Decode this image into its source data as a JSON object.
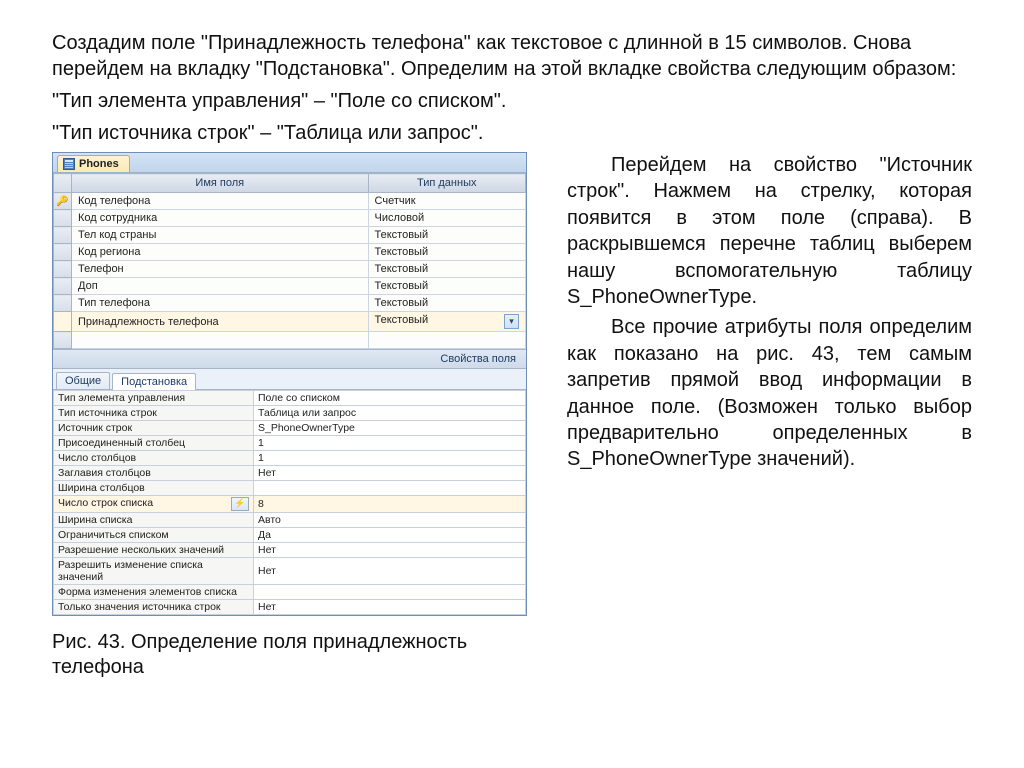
{
  "intro": {
    "p1": "Создадим поле \"Принадлежность телефона\" как текстовое с длинной в 15 символов.  Снова перейдем на вкладку \"Подстановка\". Определим на этой вкладке свойства следующим образом:",
    "p2": "\"Тип элемента управления\" – \"Поле со списком\".",
    "p3": "\"Тип источника строк\" – \"Таблица или запрос\"."
  },
  "right": {
    "p1": "Перейдем на свойство \"Источник строк\". Нажмем на стрелку, которая появится в этом поле (справа). В раскрывшемся перечне таблиц выберем нашу вспомогательную таблицу S_PhoneOwnerType.",
    "p2": "Все прочие атрибуты поля определим как показано на рис. 43, тем самым запретив прямой ввод информации в данное поле. (Возможен только выбор предварительно определенных в S_PhoneOwnerType значений)."
  },
  "figcaption": "Рис. 43. Определение поля принадлежность телефона",
  "access": {
    "tab": "Phones",
    "header": {
      "field": "Имя поля",
      "type": "Тип данных"
    },
    "fields": [
      {
        "key": true,
        "name": "Код телефона",
        "type": "Счетчик"
      },
      {
        "key": false,
        "name": "Код сотрудника",
        "type": "Числовой"
      },
      {
        "key": false,
        "name": "Тел код страны",
        "type": "Текстовый"
      },
      {
        "key": false,
        "name": "Код региона",
        "type": "Текстовый"
      },
      {
        "key": false,
        "name": "Телефон",
        "type": "Текстовый"
      },
      {
        "key": false,
        "name": "Доп",
        "type": "Текстовый"
      },
      {
        "key": false,
        "name": "Тип телефона",
        "type": "Текстовый"
      },
      {
        "key": false,
        "name": "Принадлежность телефона",
        "type": "Текстовый",
        "selected": true
      }
    ],
    "props_title": "Свойства поля",
    "tabs": {
      "general": "Общие",
      "lookup": "Подстановка"
    },
    "properties": [
      {
        "name": "Тип элемента управления",
        "value": "Поле со списком"
      },
      {
        "name": "Тип источника строк",
        "value": "Таблица или запрос"
      },
      {
        "name": "Источник строк",
        "value": "S_PhoneOwnerType"
      },
      {
        "name": "Присоединенный столбец",
        "value": "1"
      },
      {
        "name": "Число столбцов",
        "value": "1"
      },
      {
        "name": "Заглавия столбцов",
        "value": "Нет"
      },
      {
        "name": "Ширина столбцов",
        "value": ""
      },
      {
        "name": "Число строк списка",
        "value": "8",
        "current": true
      },
      {
        "name": "Ширина списка",
        "value": "Авто"
      },
      {
        "name": "Ограничиться списком",
        "value": "Да"
      },
      {
        "name": "Разрешение нескольких значений",
        "value": "Нет"
      },
      {
        "name": "Разрешить изменение списка значений",
        "value": "Нет"
      },
      {
        "name": "Форма изменения элементов списка",
        "value": ""
      },
      {
        "name": "Только значения источника строк",
        "value": "Нет"
      }
    ]
  }
}
